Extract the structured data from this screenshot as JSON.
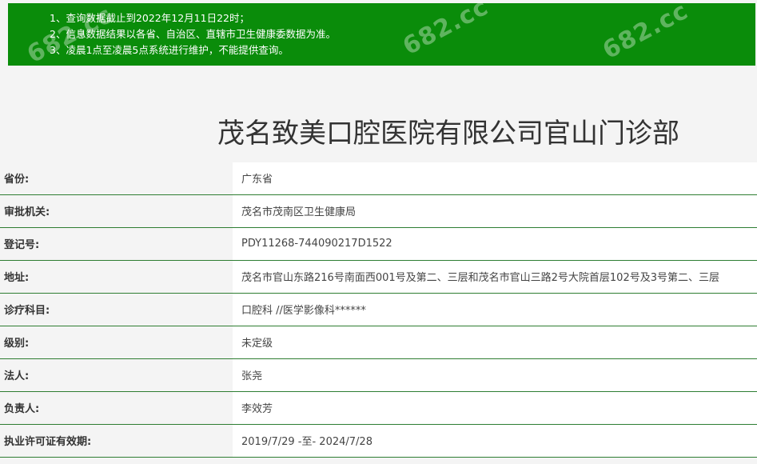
{
  "notice": {
    "lines": [
      "1、查询数据截止到2022年12月11日22时；",
      "2、信息数据结果以各省、自治区、直辖市卫生健康委数据为准。",
      "3、凌晨1点至凌晨5点系统进行维护，不能提供查询。"
    ],
    "watermark_text": "682.cc",
    "background_color": "#0a8c0a"
  },
  "hospital": {
    "name": "茂名致美口腔医院有限公司官山门诊部"
  },
  "fields": [
    {
      "label": "省份:",
      "value": "广东省"
    },
    {
      "label": "审批机关:",
      "value": "茂名市茂南区卫生健康局"
    },
    {
      "label": "登记号:",
      "value": "PDY11268-744090217D1522"
    },
    {
      "label": "地址:",
      "value": "茂名市官山东路216号南面西001号及第二、三层和茂名市官山三路2号大院首层102号及3号第二、三层"
    },
    {
      "label": "诊疗科目:",
      "value": "口腔科 //医学影像科******"
    },
    {
      "label": "级别:",
      "value": "未定级"
    },
    {
      "label": "法人:",
      "value": "张尧"
    },
    {
      "label": "负责人:",
      "value": "李效芳"
    },
    {
      "label": "执业许可证有效期:",
      "value": "2019/7/29 -至- 2024/7/28"
    }
  ],
  "colors": {
    "row_divider": "#2e7d32",
    "label_background": "#f4f4f4",
    "value_background": "#ffffff"
  }
}
